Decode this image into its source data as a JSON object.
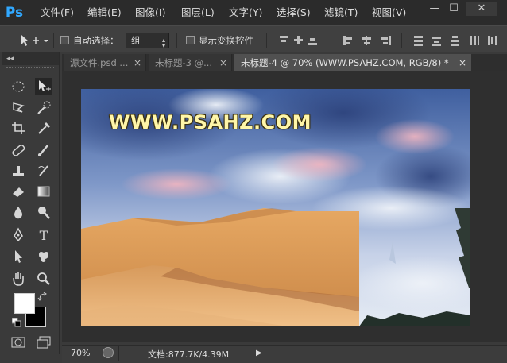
{
  "app": {
    "logo": "Ps"
  },
  "menu": [
    "文件(F)",
    "编辑(E)",
    "图像(I)",
    "图层(L)",
    "文字(Y)",
    "选择(S)",
    "滤镜(T)",
    "视图(V)"
  ],
  "window_controls": {
    "minimize": "—",
    "maximize": "☐",
    "close": "✕"
  },
  "options_bar": {
    "auto_select_label": "自动选择：",
    "auto_select_value": "组",
    "show_transform_label": "显示变换控件"
  },
  "tabs": [
    {
      "label": "源文件.psd ...",
      "close": "×"
    },
    {
      "label": "未标题-3 @...",
      "close": "×"
    },
    {
      "label": "未标题-4 @ 70% (WWW.PSAHZ.COM, RGB/8) *",
      "close": "×"
    }
  ],
  "toolbox": {
    "collapse": "◂◂"
  },
  "document": {
    "watermark_text": "WWW.PSAHZ.COM"
  },
  "status": {
    "zoom": "70%",
    "doc_info": "文档:877.7K/4.39M",
    "arrow": "▶"
  },
  "colors": {
    "foreground": "#ffffff",
    "background": "#000000",
    "accent": "#31a8ff"
  }
}
